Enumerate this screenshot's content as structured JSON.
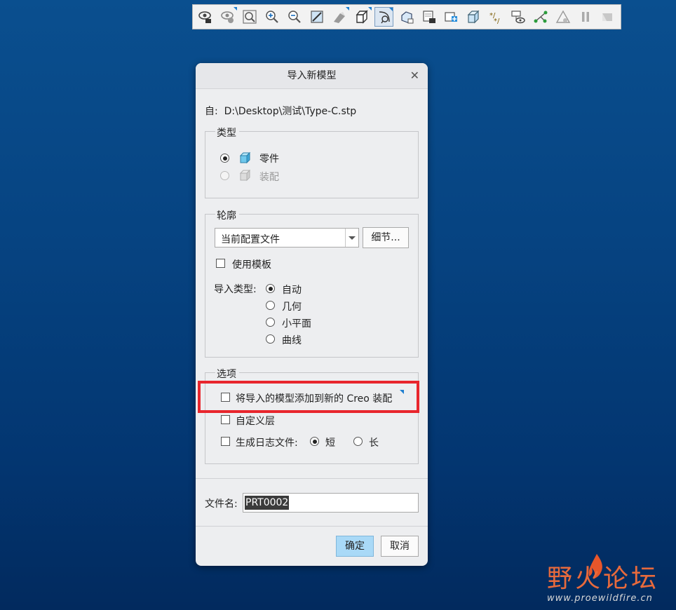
{
  "toolbar": {
    "icons": [
      "view-icon",
      "view-settings-icon",
      "zoom-fit-icon",
      "zoom-in-icon",
      "zoom-out-icon",
      "repaint-icon",
      "shading-icon",
      "orientation-cube-icon",
      "spin-center-icon",
      "saved-views-icon",
      "snapshot-icon",
      "add-view-icon",
      "transparent-box-icon",
      "datum-display-icon",
      "annotation-display-icon",
      "axis-display-icon",
      "warning-icon",
      "pause-icon",
      "flag-icon"
    ]
  },
  "dialog": {
    "title": "导入新模型",
    "from_prefix": "自:",
    "from_path": "D:\\Desktop\\测试\\Type-C.stp",
    "type_group": {
      "legend": "类型",
      "part_label": "零件",
      "assembly_label": "装配"
    },
    "profile_group": {
      "legend": "轮廓",
      "profile_value": "当前配置文件",
      "details_button": "细节...",
      "use_template_label": "使用模板",
      "import_type_label": "导入类型:",
      "import_types": [
        "自动",
        "几何",
        "小平面",
        "曲线"
      ]
    },
    "options_group": {
      "legend": "选项",
      "add_to_assembly_label": "将导入的模型添加到新的 Creo 装配",
      "custom_layer_label": "自定义层",
      "log_file_label": "生成日志文件:",
      "log_short": "短",
      "log_long": "长"
    },
    "file_name_label": "文件名:",
    "file_name_value": "PRT0002",
    "ok_button": "确定",
    "cancel_button": "取消"
  },
  "watermark": {
    "title": "野火论坛",
    "url": "www.proewildfire.cn"
  },
  "colors": {
    "background": "#064381",
    "highlight": "#e8262d",
    "primary_button": "#a9d9f7"
  }
}
